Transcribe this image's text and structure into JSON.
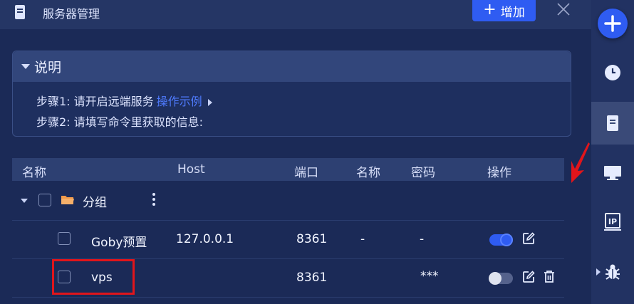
{
  "header": {
    "title": "服务器管理",
    "add_button": "增加",
    "icon": "server-icon"
  },
  "info": {
    "heading": "说明",
    "step1_prefix": "步骤1: 请开启远端服务",
    "step1_link": "操作示例",
    "step2": "步骤2: 请填写命令里获取的信息:"
  },
  "table": {
    "columns": [
      "名称",
      "Host",
      "端口",
      "名称",
      "密码",
      "操作"
    ],
    "group": {
      "label": "分组"
    },
    "rows": [
      {
        "name": "Goby预置",
        "host": "127.0.0.1",
        "port": "8361",
        "username": "-",
        "password": "-",
        "enabled": true
      },
      {
        "name": "vps",
        "host": "",
        "port": "8361",
        "username": "",
        "password": "***",
        "enabled": false
      }
    ]
  },
  "sidebar": {
    "items": [
      "add-icon",
      "history-icon",
      "server-icon",
      "monitor-icon",
      "ip-icon",
      "bug-icon"
    ]
  },
  "colors": {
    "accent": "#2f5cf2",
    "highlight": "#e1151b"
  }
}
